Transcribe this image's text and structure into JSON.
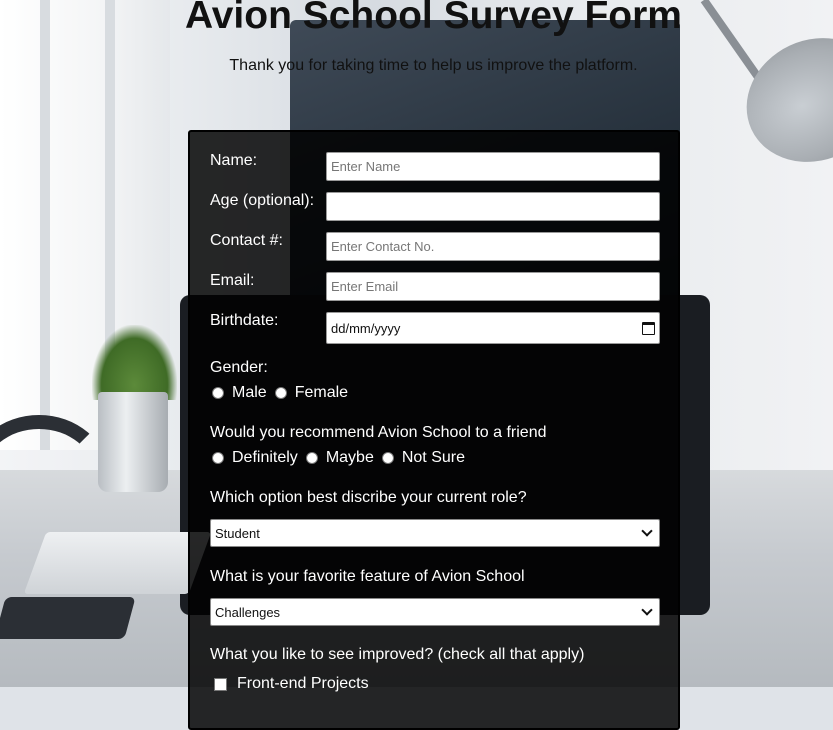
{
  "page": {
    "title": "Avion School Survey Form",
    "subtitle": "Thank you for taking time to help us improve the platform."
  },
  "form": {
    "name": {
      "label": "Name:",
      "placeholder": "Enter Name",
      "value": ""
    },
    "age": {
      "label": "Age (optional):",
      "placeholder": "",
      "value": ""
    },
    "contact": {
      "label": "Contact #:",
      "placeholder": "Enter Contact No.",
      "value": ""
    },
    "email": {
      "label": "Email:",
      "placeholder": "Enter Email",
      "value": ""
    },
    "birthdate": {
      "label": "Birthdate:",
      "value": "dd/mm/yyyy",
      "icon": "calendar-icon"
    },
    "gender": {
      "label": "Gender:",
      "options": [
        "Male",
        "Female"
      ]
    },
    "recommend": {
      "label": "Would you recommend Avion School to a friend",
      "options": [
        "Definitely",
        "Maybe",
        "Not Sure"
      ]
    },
    "role": {
      "label": "Which option best discribe your current role?",
      "selected": "Student"
    },
    "feature": {
      "label": "What is your favorite feature of Avion School",
      "selected": "Challenges"
    },
    "improve": {
      "label": "What you like to see improved? (check all that apply)",
      "options": [
        "Front-end Projects"
      ]
    }
  },
  "colors": {
    "panel_bg": "#000000",
    "text": "#ffffff",
    "title": "#111111"
  }
}
